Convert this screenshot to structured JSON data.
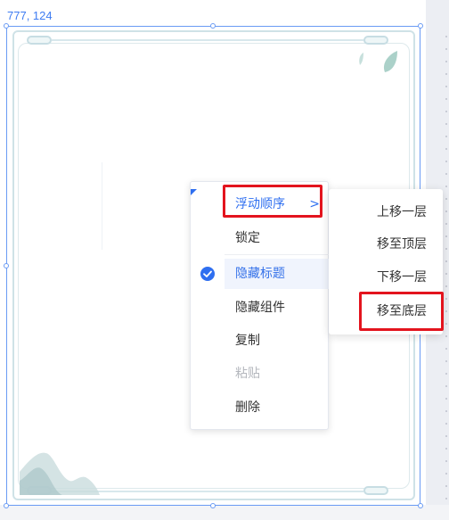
{
  "canvas": {
    "coord_label": "777, 124"
  },
  "context_menu": {
    "items": [
      {
        "label": "浮动顺序",
        "state": "hovered",
        "has_submenu": true
      },
      {
        "label": "锁定",
        "state": "normal"
      },
      {
        "label": "隐藏标题",
        "state": "checked"
      },
      {
        "label": "隐藏组件",
        "state": "normal"
      },
      {
        "label": "复制",
        "state": "normal"
      },
      {
        "label": "粘贴",
        "state": "disabled"
      },
      {
        "label": "删除",
        "state": "normal"
      }
    ],
    "submenu_chevron": ">",
    "check_icon": "check-circle-icon"
  },
  "submenu": {
    "items": [
      {
        "label": "上移一层"
      },
      {
        "label": "移至顶层"
      },
      {
        "label": "下移一层"
      },
      {
        "label": "移至底层"
      }
    ]
  },
  "colors": {
    "accent": "#2f6ff0",
    "highlight_box": "#e3141e",
    "selection": "#6a9bf4"
  }
}
